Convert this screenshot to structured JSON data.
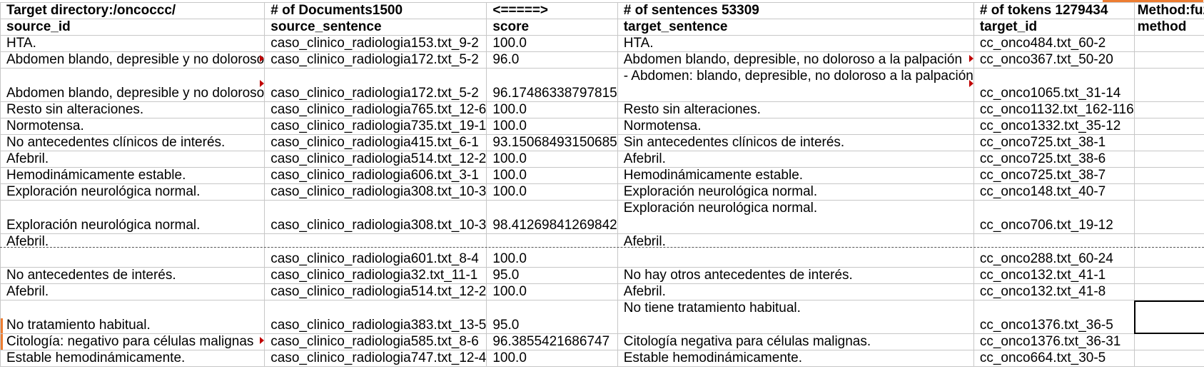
{
  "sheet": {
    "columns": [
      "source_id",
      "source_sentence",
      "score",
      "target_sentence",
      "target_id",
      "method"
    ],
    "header_row": {
      "c1": "Target directory:/oncoccc/",
      "c2": "# of Documents1500",
      "c3": "<=====>",
      "c4": "# of sentences 53309",
      "c5": "# of tokens 1279434",
      "c6": "Method:fuzzy"
    },
    "column_headers": {
      "c1": "source_id",
      "c2": "source_sentence",
      "c3": "score",
      "c4": "target_sentence",
      "c5": "target_id",
      "c6": "method"
    },
    "rows": [
      {
        "c1": "HTA.",
        "c2": "caso_clinico_radiologia153.txt_9-2",
        "c3": "100.0",
        "c4": "HTA.",
        "c5": "cc_onco484.txt_60-2",
        "c6": ""
      },
      {
        "c1": "Abdomen blando, depresible y no doloroso",
        "c2": "caso_clinico_radiologia172.txt_5-2",
        "c3": "96.0",
        "c4": "Abdomen blando, depresible, no doloroso a la palpación",
        "c5": "cc_onco367.txt_50-20",
        "c6": ""
      },
      {
        "c1": "Abdomen blando, depresible y no doloroso",
        "c2": "caso_clinico_radiologia172.txt_5-2",
        "c3": "96.17486338797815",
        "c4": "- Abdomen: blando, depresible, no doloroso a la palpación",
        "c5": "cc_onco1065.txt_31-14",
        "c6": ""
      },
      {
        "c1": "Resto sin alteraciones.",
        "c2": "caso_clinico_radiologia765.txt_12-6",
        "c3": "100.0",
        "c4": "Resto sin alteraciones.",
        "c5": "cc_onco1132.txt_162-116",
        "c6": ""
      },
      {
        "c1": "Normotensa.",
        "c2": "caso_clinico_radiologia735.txt_19-1",
        "c3": "100.0",
        "c4": "Normotensa.",
        "c5": "cc_onco1332.txt_35-12",
        "c6": ""
      },
      {
        "c1": "No antecedentes clínicos de interés.",
        "c2": "caso_clinico_radiologia415.txt_6-1",
        "c3": "93.15068493150685",
        "c4": "Sin antecedentes clínicos de interés.",
        "c5": "cc_onco725.txt_38-1",
        "c6": ""
      },
      {
        "c1": "Afebril.",
        "c2": "caso_clinico_radiologia514.txt_12-2",
        "c3": "100.0",
        "c4": "Afebril.",
        "c5": "cc_onco725.txt_38-6",
        "c6": ""
      },
      {
        "c1": "Hemodinámicamente estable.",
        "c2": "caso_clinico_radiologia606.txt_3-1",
        "c3": "100.0",
        "c4": "Hemodinámicamente estable.",
        "c5": "cc_onco725.txt_38-7",
        "c6": ""
      },
      {
        "c1": "Exploración neurológica normal.",
        "c2": "caso_clinico_radiologia308.txt_10-3",
        "c3": "100.0",
        "c4": "Exploración neurológica normal.",
        "c5": "cc_onco148.txt_40-7",
        "c6": ""
      },
      {
        "c1": "Exploración neurológica normal.",
        "c2": "caso_clinico_radiologia308.txt_10-3",
        "c3": "98.41269841269842",
        "c4": "Exploración neurológica normal.",
        "c5": "cc_onco706.txt_19-12",
        "c6": ""
      },
      {
        "c1": "Afebril.",
        "c2": "caso_clinico_radiologia601.txt_8-4",
        "c3": "100.0",
        "c4": "Afebril.",
        "c5": "cc_onco288.txt_60-24",
        "c6": ""
      },
      {
        "c1": "No antecedentes de interés.",
        "c2": "caso_clinico_radiologia32.txt_11-1",
        "c3": "95.0",
        "c4": "No hay otros antecedentes de interés.",
        "c5": "cc_onco132.txt_41-1",
        "c6": ""
      },
      {
        "c1": "Afebril.",
        "c2": "caso_clinico_radiologia514.txt_12-2",
        "c3": "100.0",
        "c4": "Afebril.",
        "c5": "cc_onco132.txt_41-8",
        "c6": ""
      },
      {
        "c1": "No tratamiento habitual.",
        "c2": "caso_clinico_radiologia383.txt_13-5",
        "c3": "95.0",
        "c4": "No tiene tratamiento habitual.",
        "c5": "cc_onco1376.txt_36-5",
        "c6": ""
      },
      {
        "c1": "Citología: negativo para células malignas",
        "c2": "caso_clinico_radiologia585.txt_8-6",
        "c3": "96.3855421686747",
        "c4": "Citología negativa para células malignas.",
        "c5": "cc_onco1376.txt_36-31",
        "c6": ""
      },
      {
        "c1": "Estable hemodinámicamente.",
        "c2": "caso_clinico_radiologia747.txt_12-4",
        "c3": "100.0",
        "c4": "Estable hemodinámicamente.",
        "c5": "cc_onco664.txt_30-5",
        "c6": ""
      }
    ]
  },
  "colors": {
    "grid_line": "#c7c7c7",
    "comment_marker": "#c00000",
    "accent": "#ed7d31"
  }
}
